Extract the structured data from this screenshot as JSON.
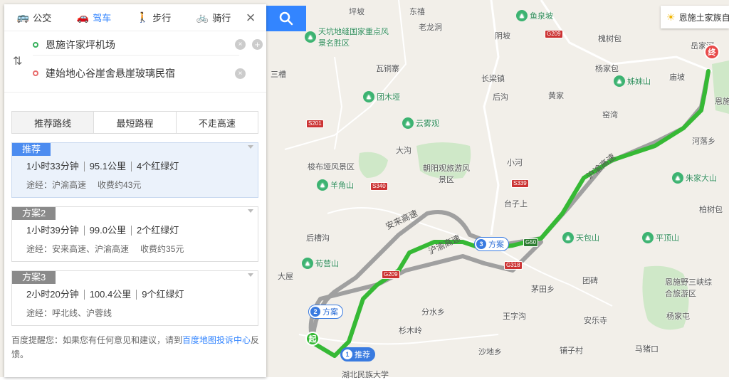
{
  "modes": [
    {
      "label": "公交",
      "icon": "bus-icon"
    },
    {
      "label": "驾车",
      "icon": "car-icon"
    },
    {
      "label": "步行",
      "icon": "walk-icon"
    },
    {
      "label": "骑行",
      "icon": "bike-icon"
    }
  ],
  "active_mode": "驾车",
  "origin": "恩施许家坪机场",
  "destination": "建始地心谷崖舍悬崖玻璃民宿",
  "preferences": [
    "推荐路线",
    "最短路程",
    "不走高速"
  ],
  "plans": [
    {
      "badge": "推荐",
      "duration": "1小时33分钟",
      "distance": "95.1公里",
      "lights": "4个红绿灯",
      "via": "途经：沪渝高速",
      "toll": "收费约43元"
    },
    {
      "badge": "方案2",
      "duration": "1小时39分钟",
      "distance": "99.0公里",
      "lights": "2个红绿灯",
      "via": "途经：安来高速、沪渝高速",
      "toll": "收费约35元"
    },
    {
      "badge": "方案3",
      "duration": "2小时20分钟",
      "distance": "100.4公里",
      "lights": "9个红绿灯",
      "via": "途经：呼北线、沪蓉线",
      "toll": ""
    }
  ],
  "feedback": {
    "before": "百度提醒您：如果您有任何意见和建议，请到",
    "link": "百度地图投诉中心",
    "after": "反馈。"
  },
  "weather": "恩施土家族自",
  "map": {
    "places": [
      "东禧",
      "坪坡",
      "老龙洞",
      "阴坡",
      "鱼泉坡",
      "槐树包",
      "岳家河",
      "瓦铜寨",
      "三槽",
      "长梁镇",
      "杨家包",
      "后沟",
      "黄家",
      "姊妹山",
      "庙坡",
      "团木垭",
      "云雾观",
      "窑湾",
      "河落乡",
      "大沟",
      "小河",
      "朱家大山",
      "梭布垭风景区",
      "朝阳观旅游风景区",
      "羊角山",
      "台子上",
      "柏树包",
      "后槽沟",
      "天包山",
      "平顶山",
      "荀营山",
      "团碑",
      "大屋",
      "恩施野三峡综合旅游区",
      "茅田乡",
      "分水乡",
      "王字沟",
      "安乐寺",
      "杨家屯",
      "杉木岭",
      "铺子村",
      "沙地乡",
      "马猪口",
      "天坑地缝国家重点风景名胜区",
      "湖北民族大学",
      "恩施"
    ],
    "roads": [
      "安来高速",
      "沪渝高速",
      "沪渝高速"
    ],
    "road_badges": [
      "G209",
      "S201",
      "G50",
      "G318",
      "S339",
      "S340",
      "G209"
    ],
    "route_tags": [
      {
        "num": "1",
        "label": "推荐"
      },
      {
        "num": "2",
        "label": "方案"
      },
      {
        "num": "3",
        "label": "方案"
      }
    ],
    "start_label": "起",
    "end_label": "终"
  }
}
